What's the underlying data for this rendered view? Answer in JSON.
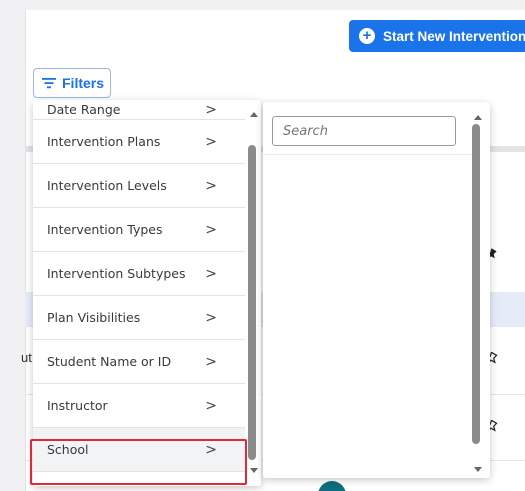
{
  "header": {
    "start_button_label": "Start New Intervention",
    "filters_button_label": "Filters"
  },
  "background": {
    "partial_text": "ut"
  },
  "filter_menu": {
    "items": [
      {
        "label": "Date Range"
      },
      {
        "label": "Intervention Plans"
      },
      {
        "label": "Intervention Levels"
      },
      {
        "label": "Intervention Types"
      },
      {
        "label": "Intervention Subtypes"
      },
      {
        "label": "Plan Visibilities"
      },
      {
        "label": "Student Name or ID"
      },
      {
        "label": "Instructor"
      },
      {
        "label": "School"
      }
    ],
    "selected": "School",
    "chevron": ">"
  },
  "submenu": {
    "search_placeholder": "Search"
  },
  "colors": {
    "accent": "#1a73e8",
    "highlight": "#e0283d",
    "teal": "#0e6d7d"
  },
  "icons": {
    "start": "plus-circle-icon",
    "filters": "filter-lines-icon",
    "pin": "pin-icon"
  }
}
